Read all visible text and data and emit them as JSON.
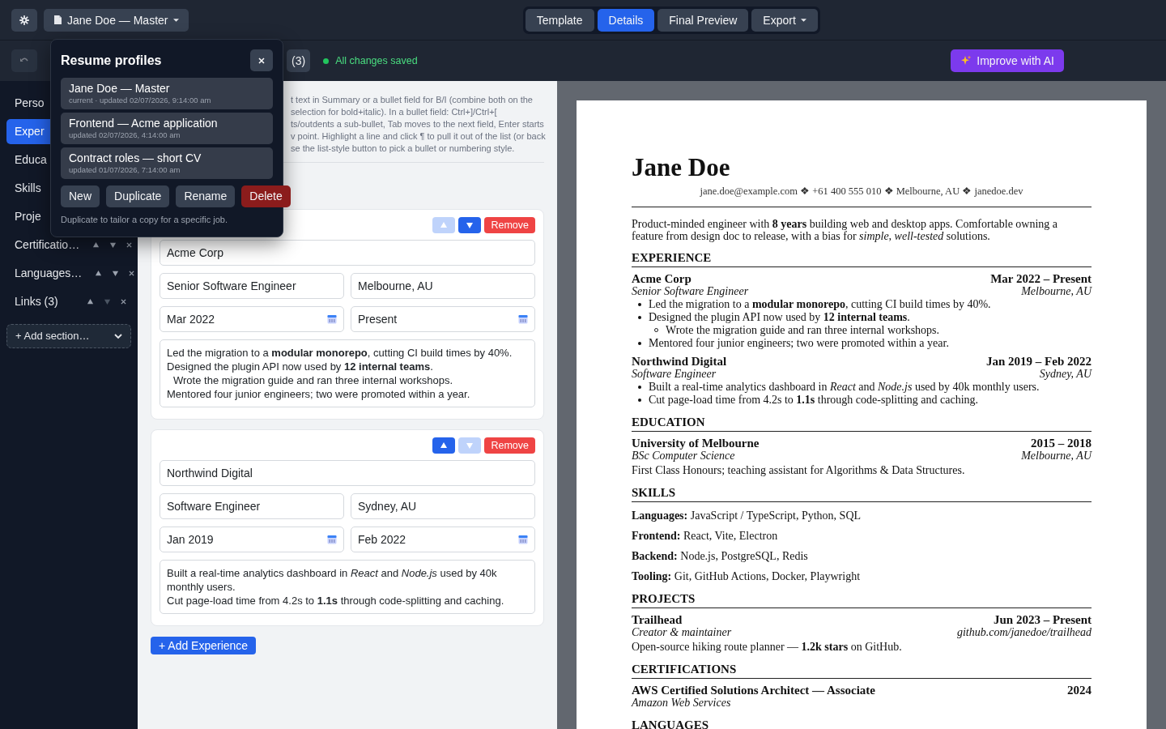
{
  "topbar": {
    "profile_button": "Jane Doe — Master",
    "view_tabs": [
      {
        "label": "Template",
        "selected": false
      },
      {
        "label": "Details",
        "selected": true
      },
      {
        "label": "Final Preview",
        "selected": false
      }
    ],
    "export_button": "Export"
  },
  "toolbar": {
    "undo_disabled": true,
    "count_button": "(3)",
    "save_status": "All changes saved",
    "ai_button": "Improve with AI"
  },
  "sidebar": {
    "items": [
      {
        "label": "Perso",
        "selected": false
      },
      {
        "label": "Exper",
        "selected": true
      },
      {
        "label": "Educa",
        "selected": false
      },
      {
        "label": "Skills",
        "selected": false
      },
      {
        "label": "Proje",
        "selected": false
      },
      {
        "label": "Certificatio…",
        "selected": false,
        "controls": {
          "up_disabled": false,
          "down_disabled": false
        }
      },
      {
        "label": "Languages…",
        "selected": false,
        "controls": {
          "up_disabled": false,
          "down_disabled": false
        }
      },
      {
        "label": "Links (3)",
        "selected": false,
        "controls": {
          "up_disabled": false,
          "down_disabled": true
        }
      }
    ],
    "add_section": "+ Add section…"
  },
  "profiles_popup": {
    "title": "Resume profiles",
    "profiles": [
      {
        "name": "Jane Doe — Master",
        "meta": "current · updated 02/07/2026, 9:14:00 am"
      },
      {
        "name": "Frontend — Acme application",
        "meta": "updated 02/07/2026, 4:14:00 am"
      },
      {
        "name": "Contract roles — short CV",
        "meta": "updated 01/07/2026, 7:14:00 am"
      }
    ],
    "actions": [
      {
        "label": "New",
        "kind": "default"
      },
      {
        "label": "Duplicate",
        "kind": "default"
      },
      {
        "label": "Rename",
        "kind": "default"
      },
      {
        "label": "Delete",
        "kind": "danger"
      }
    ],
    "hint": "Duplicate to tailor a copy for a specific job."
  },
  "editor": {
    "help_lines": [
      "t text in Summary or a bullet field for B/I (combine both on the",
      "selection for bold+italic). In a bullet field: Ctrl+]/Ctrl+[",
      "ts/outdents a sub-bullet, Tab moves to the next field, Enter starts",
      "v point. Highlight a line and click ¶ to pull it out of the list (or back",
      "se the list-style button to pick a bullet or numbering style."
    ],
    "entries": [
      {
        "company": "Acme Corp",
        "title": "Senior Software Engineer",
        "location": "Melbourne, AU",
        "start_date": "Mar 2022",
        "end_date": "Present",
        "can_move_up": false,
        "can_move_down": true,
        "remove_button": "Remove",
        "bullets": [
          {
            "text": "Led the migration to a **modular monorepo**, cutting CI build times by 40%."
          },
          {
            "text": "Designed the plugin API now used by **12 internal teams**.",
            "children": [
              {
                "text": "Wrote the migration guide and ran three internal workshops."
              }
            ]
          },
          {
            "text": "Mentored four junior engineers; two were promoted within a year."
          }
        ]
      },
      {
        "company": "Northwind Digital",
        "title": "Software Engineer",
        "location": "Sydney, AU",
        "start_date": "Jan 2019",
        "end_date": "Feb 2022",
        "can_move_up": true,
        "can_move_down": false,
        "remove_button": "Remove",
        "bullets": [
          {
            "text": "Built a real-time analytics dashboard in *React* and *Node.js* used by 40k monthly users."
          },
          {
            "text": "Cut page-load time from 4.2s to **1.1s** through code-splitting and caching."
          }
        ]
      }
    ],
    "add_button": "+ Add Experience"
  },
  "preview": {
    "name": "Jane Doe",
    "contact": "jane.doe@example.com ❖ +61 400 555 010 ❖ Melbourne, AU ❖ janedoe.dev",
    "summary": "Product-minded engineer with **8 years** building web and desktop apps. Comfortable owning a feature from design doc to release, with a bias for *simple, well-tested* solutions.",
    "sections": [
      {
        "heading": "EXPERIENCE",
        "kind": "entries",
        "items": [
          {
            "title": "Acme Corp",
            "date": "Mar 2022 – Present",
            "subtitle": "Senior Software Engineer",
            "location": "Melbourne, AU",
            "bullets": [
              {
                "text": "Led the migration to a **modular monorepo**, cutting CI build times by 40%."
              },
              {
                "text": "Designed the plugin API now used by **12 internal teams**.",
                "children": [
                  {
                    "text": "Wrote the migration guide and ran three internal workshops."
                  }
                ]
              },
              {
                "text": "Mentored four junior engineers; two were promoted within a year."
              }
            ]
          },
          {
            "title": "Northwind Digital",
            "date": "Jan 2019 – Feb 2022",
            "subtitle": "Software Engineer",
            "location": "Sydney, AU",
            "bullets": [
              {
                "text": "Built a real-time analytics dashboard in *React* and *Node.js* used by 40k monthly users."
              },
              {
                "text": "Cut page-load time from 4.2s to **1.1s** through code-splitting and caching."
              }
            ]
          }
        ]
      },
      {
        "heading": "EDUCATION",
        "kind": "entries",
        "items": [
          {
            "title": "University of Melbourne",
            "date": "2015 – 2018",
            "subtitle": "BSc Computer Science",
            "location": "Melbourne, AU",
            "description": "First Class Honours; teaching assistant for Algorithms & Data Structures."
          }
        ]
      },
      {
        "heading": "SKILLS",
        "kind": "skills",
        "items": [
          "**Languages:** JavaScript / TypeScript, Python, SQL",
          "**Frontend:** React, Vite, Electron",
          "**Backend:** Node.js, PostgreSQL, Redis",
          "**Tooling:** Git, GitHub Actions, Docker, Playwright"
        ]
      },
      {
        "heading": "PROJECTS",
        "kind": "entries",
        "items": [
          {
            "title": "Trailhead",
            "date": "Jun 2023 – Present",
            "subtitle": "Creator & maintainer",
            "location": "github.com/janedoe/trailhead",
            "description": "Open-source hiking route planner — **1.2k stars** on GitHub."
          }
        ]
      },
      {
        "heading": "CERTIFICATIONS",
        "kind": "entries",
        "items": [
          {
            "title": "AWS Certified Solutions Architect — Associate",
            "date": "2024",
            "subtitle": "Amazon Web Services"
          }
        ]
      },
      {
        "heading": "LANGUAGES",
        "kind": "entries"
      }
    ]
  }
}
